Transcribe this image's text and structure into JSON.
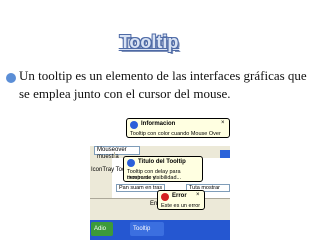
{
  "slide": {
    "title": "Tooltip",
    "bullet_text": "Un tooltip es un elemento de las interfaces gráficas que se emplea junto con el cursor del mouse."
  },
  "screenshot": {
    "tip_info": {
      "title": "Informacion",
      "body": "Tooltip con color cuando Mouse Over"
    },
    "mouseover_field": "Mouseover muestra",
    "icon_label": "IconTray Tool",
    "tip_titled": {
      "title": "Titulo del Tooltip",
      "body_line1": "Tooltip con delay para mostrarse y",
      "body_line2": "tiempo de visibilidad..."
    },
    "fields": {
      "left": "Pan suam en tras",
      "right": "Tuta mostrar tras"
    },
    "status": {
      "cell1": "En 1"
    },
    "tip_error": {
      "title": "Error",
      "body": "Este es un error"
    },
    "taskbar": {
      "start": "Adio",
      "item": "Tooltip"
    }
  },
  "colors": {
    "title_fill": "#d9e3f4",
    "title_outline": "#4e6aa6",
    "bullet": "#5b8ed6",
    "tip_bg": "#ffffe1",
    "info_icon": "#2b5fd9",
    "error_icon": "#d42121",
    "taskbar": "#2557d1"
  }
}
